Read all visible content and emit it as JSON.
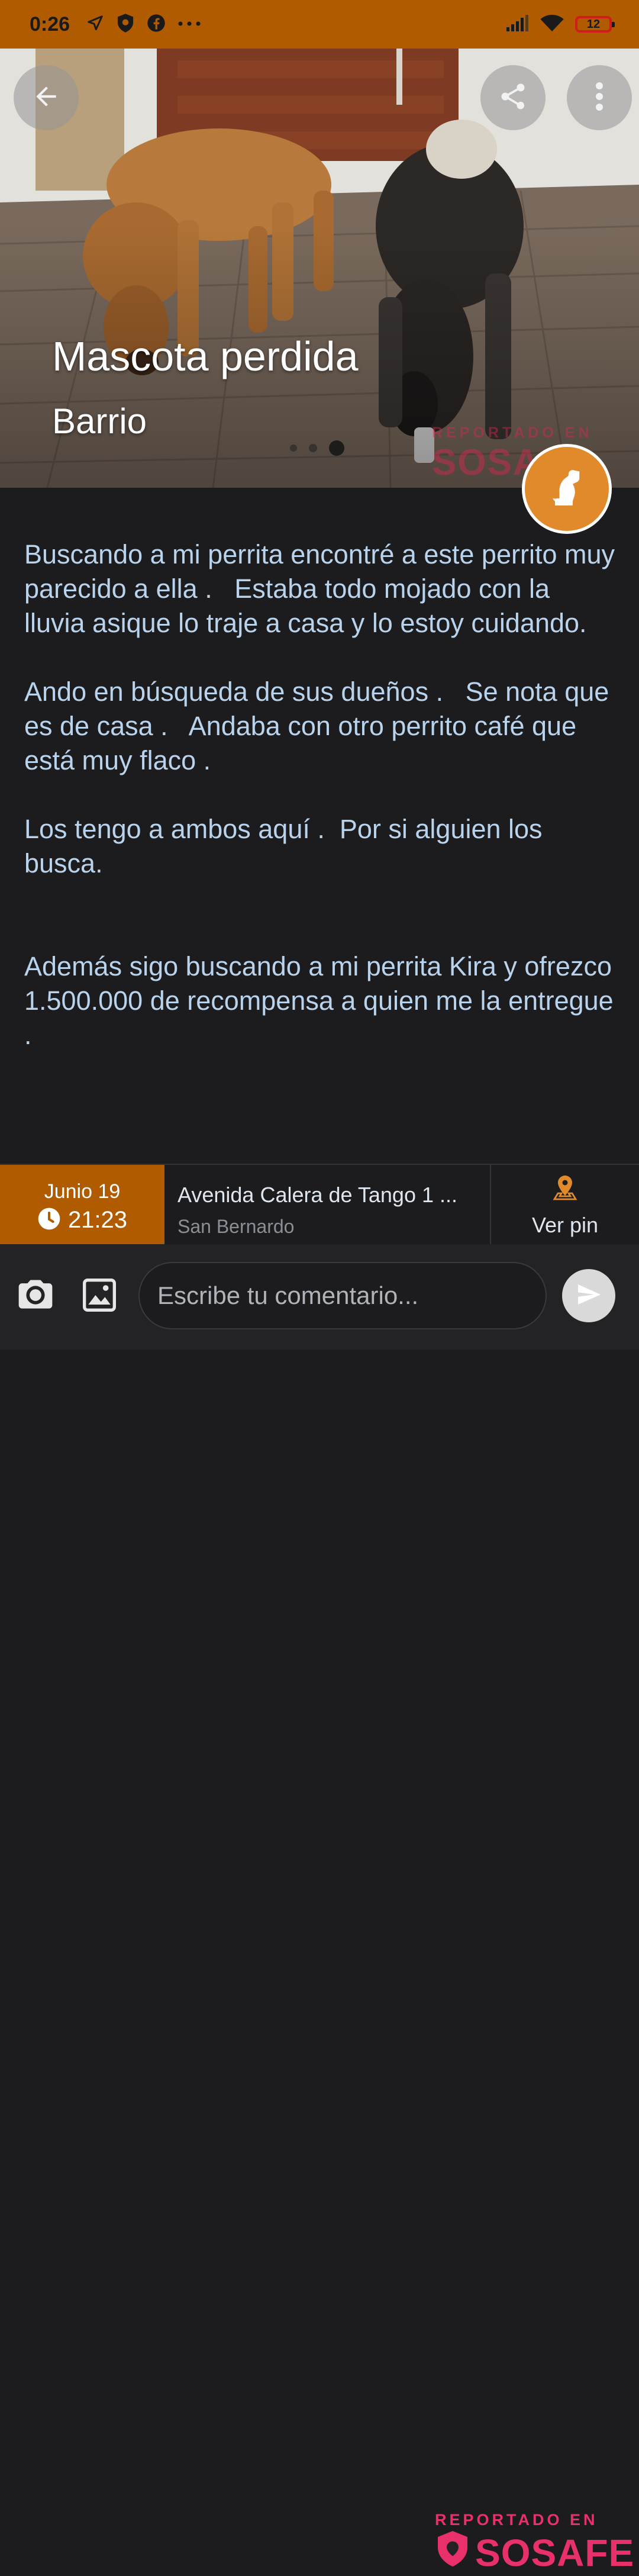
{
  "status_bar": {
    "time": "0:26",
    "battery": "12"
  },
  "hero": {
    "title": "Mascota perdida",
    "subtitle": "Barrio",
    "watermark_small": "REPORTADO EN",
    "watermark_big": "SOSAFE",
    "carousel_dots": 3,
    "active_dot": 2
  },
  "description": {
    "paragraphs": [
      "Buscando a mi perrita encontré a este perrito muy parecido a ella .   Estaba todo mojado con la lluvia asique lo traje a casa y lo estoy cuidando.",
      "Ando en búsqueda de sus dueños .   Se nota que es de casa .   Andaba con otro perrito café que está muy flaco .",
      "Los tengo a ambos aquí .  Por si alguien los busca.",
      "Además sigo buscando a mi perrita Kira y ofrezco 1.500.000 de recompensa a quien me la entregue ."
    ]
  },
  "info": {
    "date": "Junio 19",
    "time": "21:23",
    "address": "Avenida Calera de Tango  1 ...",
    "city": "San Bernardo",
    "pin_label": "Ver pin"
  },
  "composer": {
    "placeholder": "Escribe tu comentario...",
    "watermark_small": "REPORTADO EN",
    "watermark_big": "SOSAFE"
  },
  "colors": {
    "accent": "#b15b00",
    "badge": "#e08a2c",
    "text": "#b9d3ec",
    "watermark": "#e8316a"
  }
}
